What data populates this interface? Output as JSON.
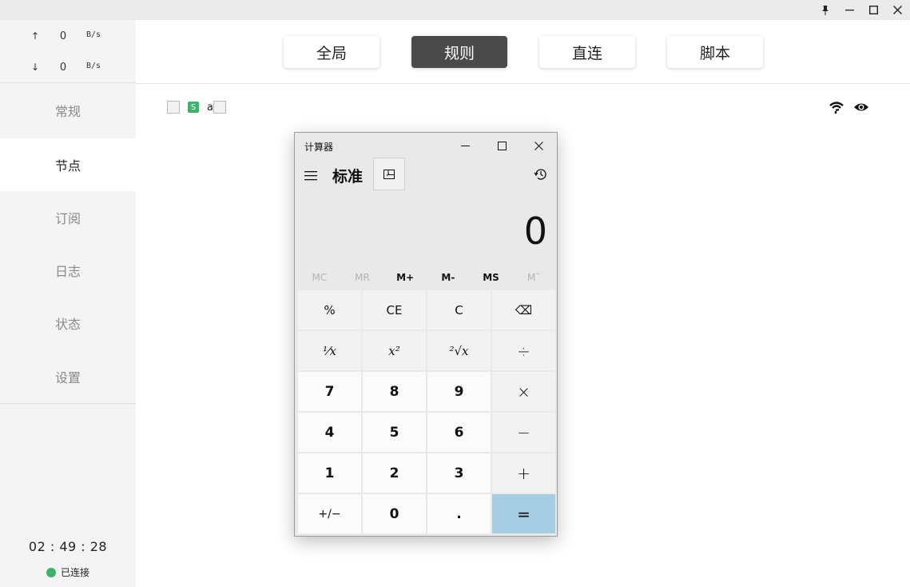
{
  "window_controls": {
    "pin": "pin-icon",
    "minimize": "minimize-icon",
    "maximize": "maximize-icon",
    "close": "close-icon"
  },
  "traffic": {
    "up": {
      "arrow": "↑",
      "value": "0",
      "unit": "B/s"
    },
    "down": {
      "arrow": "↓",
      "value": "0",
      "unit": "B/s"
    }
  },
  "sidebar": {
    "items": [
      {
        "label": "常规"
      },
      {
        "label": "节点"
      },
      {
        "label": "订阅"
      },
      {
        "label": "日志"
      },
      {
        "label": "状态"
      },
      {
        "label": "设置"
      }
    ],
    "active_index": 1,
    "clock": "02 : 49 : 28",
    "connection_status": "已连接",
    "connection_color": "#3db26a"
  },
  "modes": [
    {
      "label": "全局"
    },
    {
      "label": "规则"
    },
    {
      "label": "直连"
    },
    {
      "label": "脚本"
    }
  ],
  "active_mode_index": 1,
  "status_row": {
    "badge": "S",
    "text": "a"
  },
  "calculator": {
    "title": "计算器",
    "mode": "标准",
    "display": "0",
    "memory": [
      "MC",
      "MR",
      "M+",
      "M-",
      "MS",
      "M˘"
    ],
    "memory_disabled": [
      true,
      true,
      false,
      false,
      false,
      true
    ],
    "keys": [
      [
        "%",
        "CE",
        "C",
        "⌫"
      ],
      [
        "⅟x",
        "x²",
        "²√x",
        "÷"
      ],
      [
        "7",
        "8",
        "9",
        "×"
      ],
      [
        "4",
        "5",
        "6",
        "−"
      ],
      [
        "1",
        "2",
        "3",
        "+"
      ],
      [
        "+/−",
        "0",
        ".",
        "="
      ]
    ]
  }
}
